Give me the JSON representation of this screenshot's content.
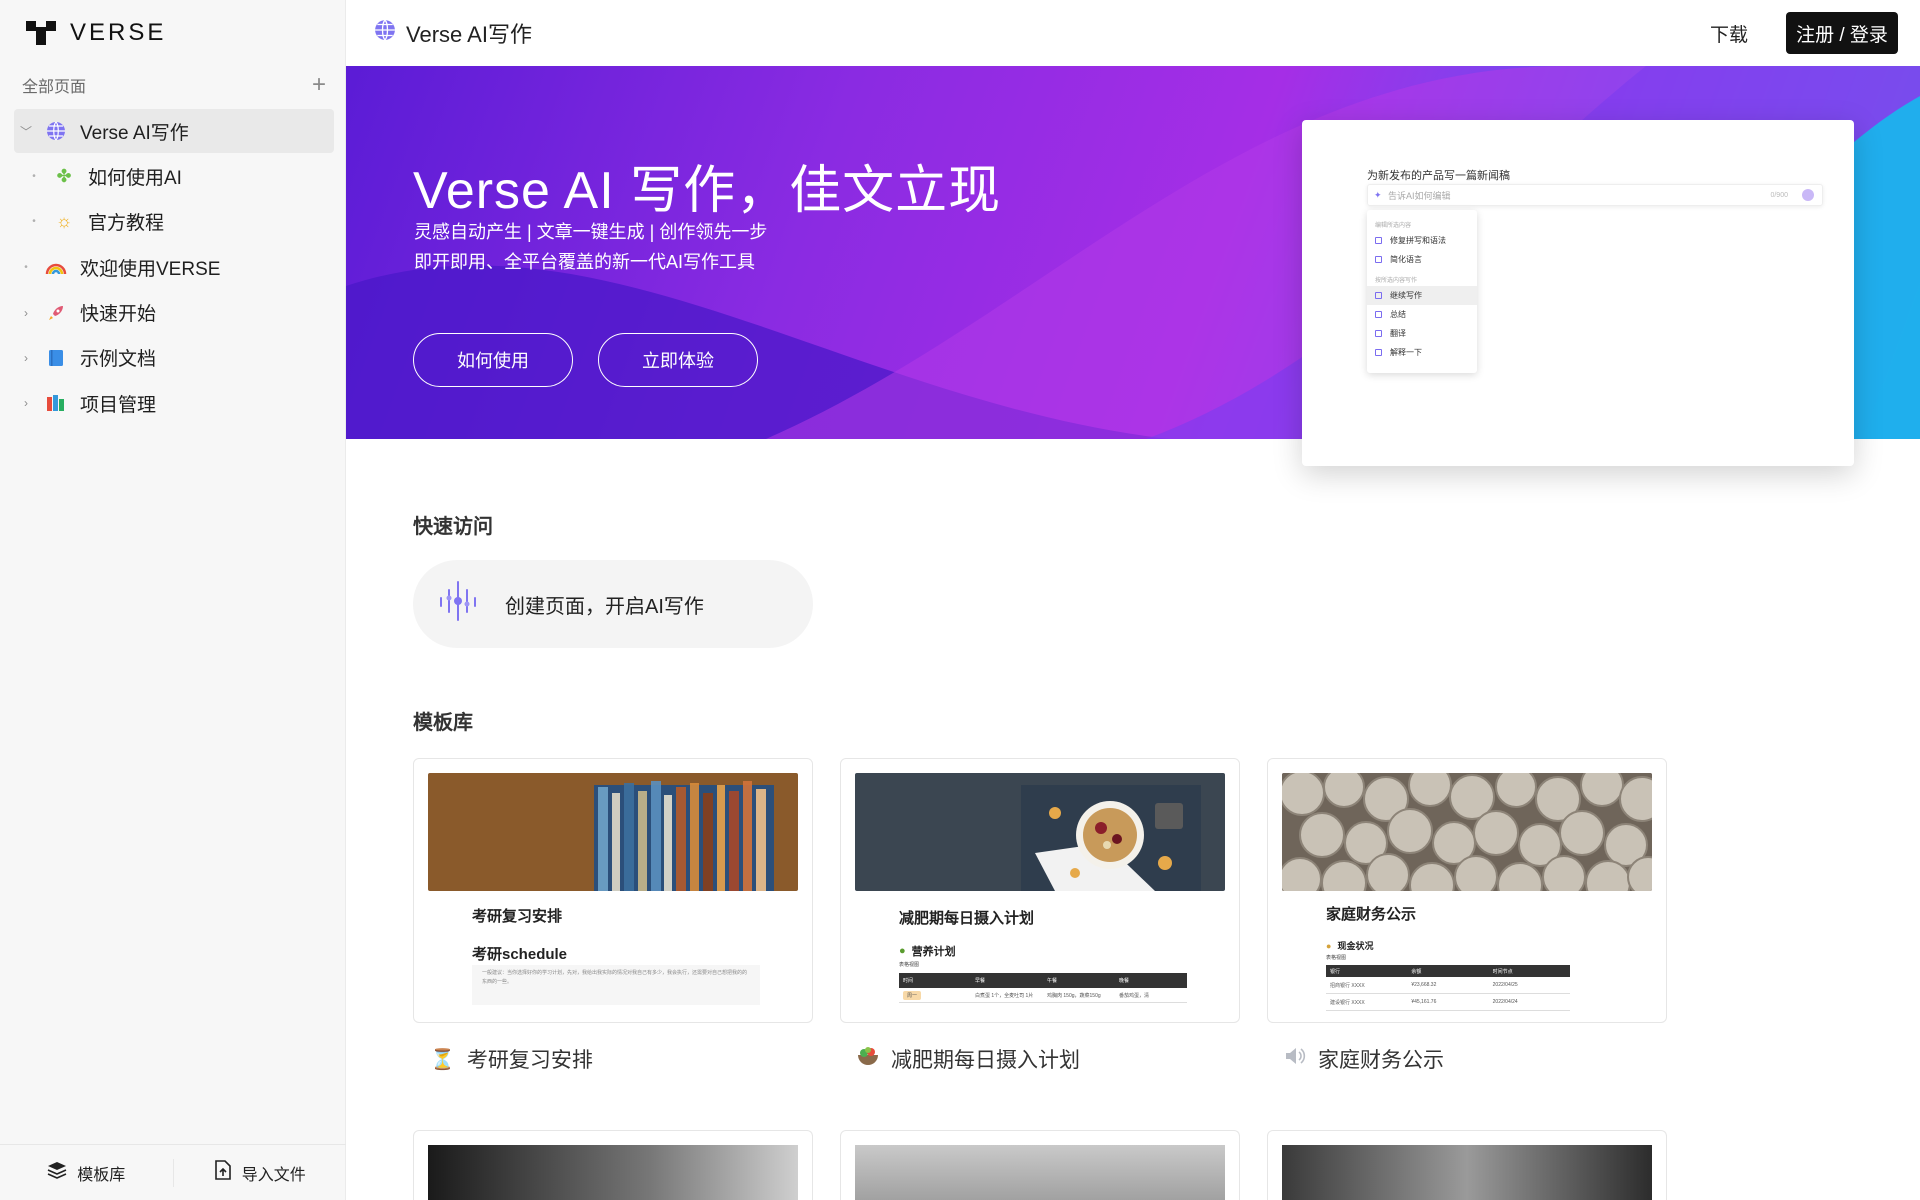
{
  "sidebar": {
    "logo": "VERSE",
    "all_pages": "全部页面",
    "add": "+",
    "items": [
      {
        "label": "Verse AI写作",
        "icon": "globe-icon",
        "expanded": true,
        "active": true
      },
      {
        "label": "如何使用AI",
        "icon": "puzzle-icon",
        "child": true
      },
      {
        "label": "官方教程",
        "icon": "sun-icon",
        "child": true
      },
      {
        "label": "欢迎使用VERSE",
        "icon": "rainbow-icon"
      },
      {
        "label": "快速开始",
        "icon": "rocket-icon"
      },
      {
        "label": "示例文档",
        "icon": "book-icon"
      },
      {
        "label": "项目管理",
        "icon": "books-icon"
      }
    ],
    "bottom": {
      "templates": "模板库",
      "import": "导入文件"
    }
  },
  "topbar": {
    "title": "Verse AI写作",
    "download": "下载",
    "login": "注册 / 登录"
  },
  "hero": {
    "title": "Verse AI 写作，佳文立现",
    "sub1": "灵感自动产生 | 文章一键生成 | 创作领先一步",
    "sub2": "即开即用、全平台覆盖的新一代AI写作工具",
    "btn_how": "如何使用",
    "btn_try": "立即体验",
    "mock": {
      "question": "为新发布的产品写一篇新闻稿",
      "placeholder": "告诉AI如何编辑",
      "count": "0/900",
      "group1": "编辑所选内容",
      "fix": "修复拼写和语法",
      "simplify": "简化语言",
      "group2": "按所选内容写作",
      "continue": "继续写作",
      "summary": "总结",
      "translate": "翻译",
      "explain": "解释一下"
    }
  },
  "quick": {
    "title": "快速访问",
    "create": "创建页面，开启AI写作"
  },
  "templates": {
    "title": "模板库",
    "cards": [
      {
        "label": "考研复习安排",
        "doc_title": "考研复习安排",
        "doc_sub": "考研schedule",
        "icon": "hourglass-icon",
        "banner": "#8a5a2b",
        "note": "一般建议：当你选择好你的学习计划，先对，我给出我实际的情况对我自己有多少，我会执行，还需要对自己想把我的的东西的一些。"
      },
      {
        "label": "减肥期每日摄入计划",
        "doc_title": "减肥期每日摄入计划",
        "doc_sub": "营养计划",
        "icon": "salad-icon",
        "banner": "#3b4651",
        "table_view": "表格视图",
        "table_head": [
          "时间",
          "早餐",
          "午餐",
          "晚餐"
        ],
        "table_row": [
          "周一",
          "白煮蛋 1个，全麦吐司 1片",
          "鸡胸肉 150g，蔬菜150g",
          "番茄鸡蛋，清"
        ]
      },
      {
        "label": "家庭财务公示",
        "doc_title": "家庭财务公示",
        "doc_sub": "现金状况",
        "icon": "speaker-icon",
        "banner": "#7a6e62",
        "table_view": "表格视图",
        "table_head": [
          "银行",
          "余额",
          "时间节点"
        ],
        "table_rows": [
          [
            "招商银行 XXXX",
            "¥23,668.32",
            "2022/04/25"
          ],
          [
            "建设银行 XXXX",
            "¥45,161.76",
            "2022/04/24"
          ]
        ]
      }
    ]
  }
}
